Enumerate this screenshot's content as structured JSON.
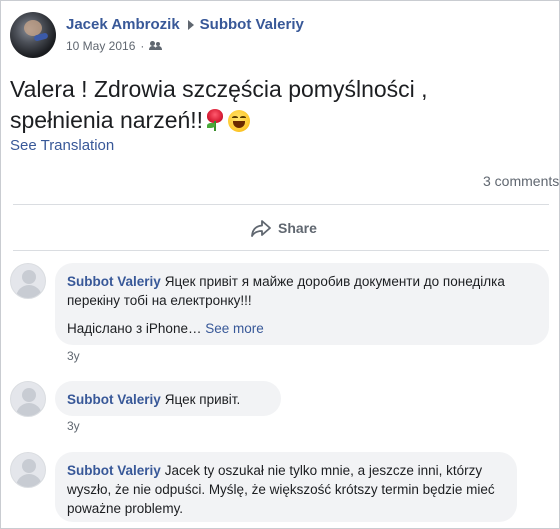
{
  "post": {
    "author": "Jacek Ambrozik",
    "recipient": "Subbot Valeriy",
    "date": "10 May 2016",
    "text_line1": "Valera ! Zdrowia szczęścia pomyślności ,",
    "text_line2": "spełnienia narzeń!!",
    "see_translation": "See Translation",
    "comments_count": "3 comments",
    "share_label": "Share"
  },
  "comments": [
    {
      "author": "Subbot Valeriy",
      "text": "Яцек привіт я майже доробив документи до понеділка перекіну тобі на електронку!!!",
      "text2": "Надіслано з iPhone… ",
      "see_more": "See more",
      "time": "3y"
    },
    {
      "author": "Subbot Valeriy",
      "text": "Яцек привіт.",
      "time": "3y"
    },
    {
      "author": "Subbot Valeriy",
      "text": "Jacek ty oszukał nie tylko mnie, a jeszcze inni, którzy wyszło, że nie odpuści. Myślę, że większość krótszy termin będzie mieć poważne problemy."
    }
  ],
  "icons": {
    "post_arrow": "caret-right-icon",
    "audience": "friends-icon",
    "share": "share-arrow-icon",
    "emoji1": "rose-emoji",
    "emoji2": "grinning-face-emoji"
  },
  "colors": {
    "link": "#385898",
    "meta": "#606770",
    "bubble": "#f2f3f5"
  }
}
